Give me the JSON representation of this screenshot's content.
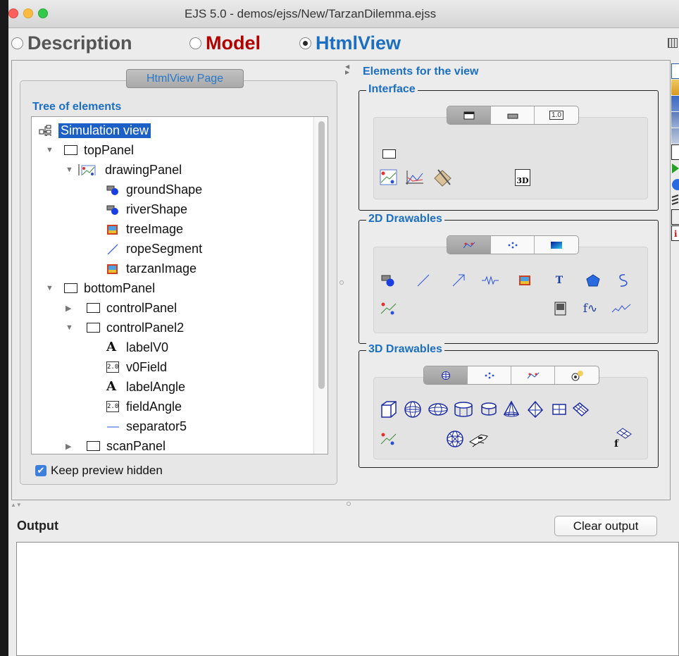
{
  "window": {
    "title": "EJS 5.0 - demos/ejss/New/TarzanDilemma.ejss"
  },
  "modes": {
    "description": "Description",
    "model": "Model",
    "htmlview": "HtmlView",
    "selected": "HtmlView"
  },
  "left_panel": {
    "page_tab": "HtmlView Page",
    "tree_label": "Tree of elements",
    "tree": [
      {
        "label": "Simulation view",
        "icon": "tree-icon",
        "selected": true
      },
      {
        "label": "topPanel",
        "icon": "panel-icon",
        "expanded": true
      },
      {
        "label": "drawingPanel",
        "icon": "drawing-panel-icon",
        "expanded": true
      },
      {
        "label": "groundShape",
        "icon": "shape-icon"
      },
      {
        "label": "riverShape",
        "icon": "shape-icon"
      },
      {
        "label": "treeImage",
        "icon": "image-icon"
      },
      {
        "label": "ropeSegment",
        "icon": "segment-icon"
      },
      {
        "label": "tarzanImage",
        "icon": "image-icon"
      },
      {
        "label": "bottomPanel",
        "icon": "panel-icon",
        "expanded": true
      },
      {
        "label": "controlPanel",
        "icon": "panel-icon",
        "expanded": false
      },
      {
        "label": "controlPanel2",
        "icon": "panel-icon",
        "expanded": true
      },
      {
        "label": "labelV0",
        "icon": "label-icon"
      },
      {
        "label": "v0Field",
        "icon": "field-icon"
      },
      {
        "label": "labelAngle",
        "icon": "label-icon"
      },
      {
        "label": "fieldAngle",
        "icon": "field-icon"
      },
      {
        "label": "separator5",
        "icon": "separator-icon"
      },
      {
        "label": "scanPanel",
        "icon": "panel-icon",
        "expanded": false
      }
    ],
    "keep_preview": {
      "label": "Keep preview hidden",
      "checked": true
    },
    "field_text": "2.0"
  },
  "right_panel": {
    "title": "Elements for the view",
    "groups": {
      "interface": {
        "title": "Interface",
        "seg_label": "1.0",
        "badge": "3D"
      },
      "drawables2d": {
        "title": "2D Drawables",
        "text_glyph": "T"
      },
      "drawables3d": {
        "title": "3D Drawables"
      }
    }
  },
  "output": {
    "label": "Output",
    "clear_button": "Clear output",
    "text": ""
  },
  "colors": {
    "accent": "#1c6fc0",
    "model": "#b00000",
    "selection": "#1c5fc7"
  }
}
